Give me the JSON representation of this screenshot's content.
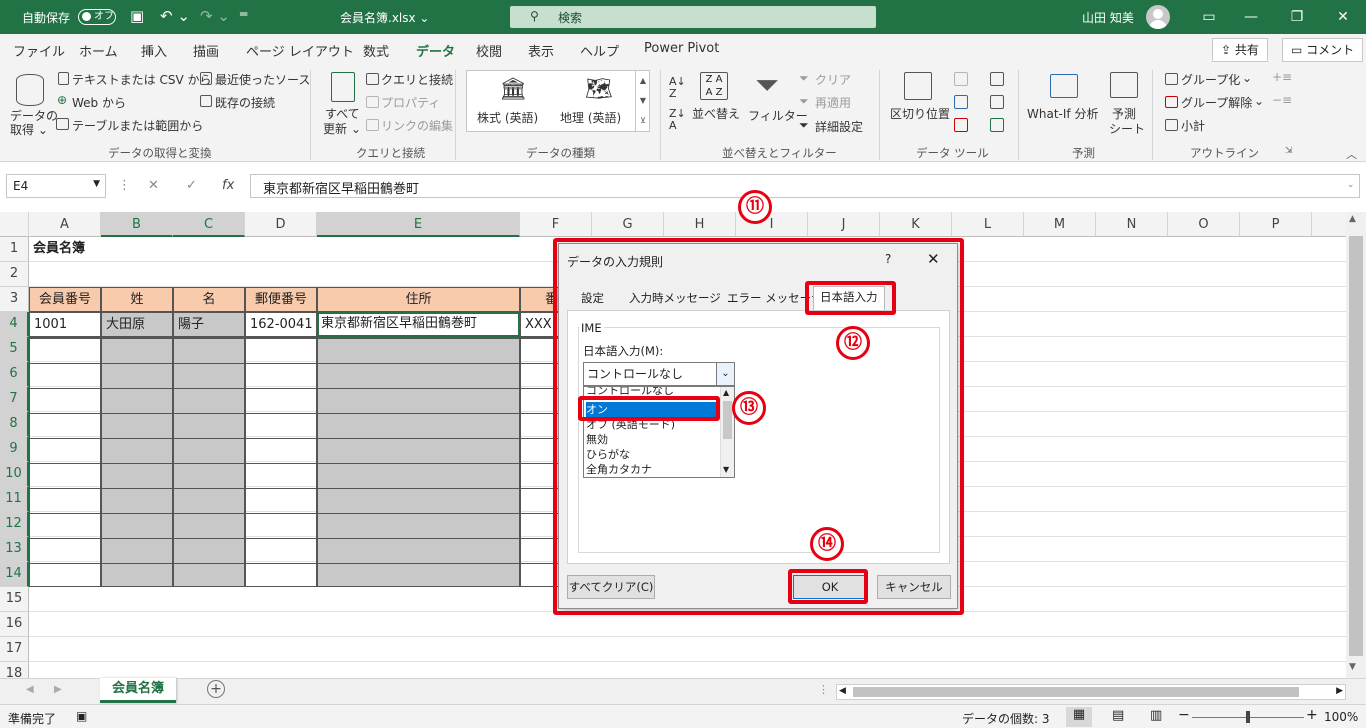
{
  "titlebar": {
    "autosave": "自動保存",
    "toggle": "オフ",
    "filename": "会員名簿.xlsx ⌄",
    "search": "検索",
    "user": "山田 知美"
  },
  "menu": [
    "ファイル",
    "ホーム",
    "挿入",
    "描画",
    "ページ レイアウト",
    "数式",
    "データ",
    "校閲",
    "表示",
    "ヘルプ",
    "Power Pivot"
  ],
  "share": "共有",
  "comment": "コメント",
  "ribbon": {
    "get_data": [
      "データの",
      "取得 ⌄"
    ],
    "text_csv": "テキストまたは CSV から",
    "web": "Web から",
    "table_range": "テーブルまたは範囲から",
    "recent": "最近使ったソース",
    "existing": "既存の接続",
    "refresh": [
      "すべて",
      "更新 ⌄"
    ],
    "queries": "クエリと接続",
    "properties": "プロパティ",
    "edit_links": "リンクの編集",
    "stocks": "株式 (英語)",
    "geography": "地理 (英語)",
    "sort": "並べ替え",
    "filter": "フィルター",
    "clear": "クリア",
    "reapply": "再適用",
    "advanced": "詳細設定",
    "text_to_columns": "区切り位置",
    "whatif": "What-If 分析",
    "forecast": [
      "予測",
      "シート"
    ],
    "group": "グループ化",
    "ungroup": "グループ解除",
    "subtotal": "小計",
    "groups": [
      "データの取得と変換",
      "クエリと接続",
      "データの種類",
      "並べ替えとフィルター",
      "データ ツール",
      "予測",
      "アウトライン"
    ]
  },
  "formula": {
    "namebox": "E4",
    "value": "東京都新宿区早稲田鶴巻町"
  },
  "columns": [
    "A",
    "B",
    "C",
    "D",
    "E",
    "F",
    "G",
    "H",
    "I",
    "J",
    "K",
    "L",
    "M",
    "N",
    "O",
    "P"
  ],
  "rows": [
    "1",
    "2",
    "3",
    "4",
    "5",
    "6",
    "7",
    "8",
    "9",
    "10",
    "11",
    "12",
    "13",
    "14",
    "15",
    "16",
    "17",
    "18"
  ],
  "sheet": {
    "title": "会員名簿",
    "headers": [
      "会員番号",
      "姓",
      "名",
      "郵便番号",
      "住所",
      "番"
    ],
    "row4": [
      "1001",
      "大田原",
      "陽子",
      "162-0041",
      "東京都新宿区早稲田鶴巻町",
      "XXX"
    ]
  },
  "tabname": "会員名簿",
  "status": {
    "ready": "準備完了",
    "count": "データの個数: 3",
    "zoom": "100%"
  },
  "dialog": {
    "title": "データの入力規則",
    "help": "?",
    "tabs": [
      "設定",
      "入力時メッセージ",
      "エラー メッセージ",
      "日本語入力"
    ],
    "ime_label": "IME",
    "field_label": "日本語入力(M):",
    "selected": "コントロールなし",
    "options": [
      "コントロールなし",
      "オン",
      "オフ (英語モード)",
      "無効",
      "ひらがな",
      "全角カタカナ"
    ],
    "clear_all": "すべてクリア(C)",
    "ok": "OK",
    "cancel": "キャンセル"
  },
  "callouts": [
    "⑪",
    "⑫",
    "⑬",
    "⑭"
  ],
  "colors": {
    "excel_green": "#217346",
    "callout_red": "#e60012",
    "header_fill": "#f8cbad",
    "selection_blue": "#0078d7"
  }
}
